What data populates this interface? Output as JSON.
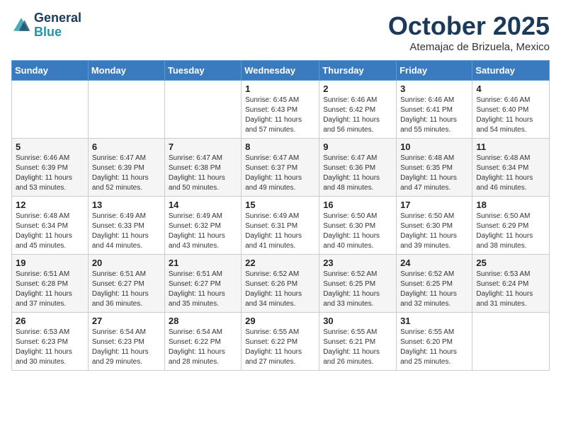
{
  "header": {
    "logo_line1": "General",
    "logo_line2": "Blue",
    "month_title": "October 2025",
    "subtitle": "Atemajac de Brizuela, Mexico"
  },
  "days_of_week": [
    "Sunday",
    "Monday",
    "Tuesday",
    "Wednesday",
    "Thursday",
    "Friday",
    "Saturday"
  ],
  "weeks": [
    [
      {
        "day": "",
        "sunrise": "",
        "sunset": "",
        "daylight": ""
      },
      {
        "day": "",
        "sunrise": "",
        "sunset": "",
        "daylight": ""
      },
      {
        "day": "",
        "sunrise": "",
        "sunset": "",
        "daylight": ""
      },
      {
        "day": "1",
        "sunrise": "6:45 AM",
        "sunset": "6:43 PM",
        "daylight": "11 hours and 57 minutes."
      },
      {
        "day": "2",
        "sunrise": "6:46 AM",
        "sunset": "6:42 PM",
        "daylight": "11 hours and 56 minutes."
      },
      {
        "day": "3",
        "sunrise": "6:46 AM",
        "sunset": "6:41 PM",
        "daylight": "11 hours and 55 minutes."
      },
      {
        "day": "4",
        "sunrise": "6:46 AM",
        "sunset": "6:40 PM",
        "daylight": "11 hours and 54 minutes."
      }
    ],
    [
      {
        "day": "5",
        "sunrise": "6:46 AM",
        "sunset": "6:39 PM",
        "daylight": "11 hours and 53 minutes."
      },
      {
        "day": "6",
        "sunrise": "6:47 AM",
        "sunset": "6:39 PM",
        "daylight": "11 hours and 52 minutes."
      },
      {
        "day": "7",
        "sunrise": "6:47 AM",
        "sunset": "6:38 PM",
        "daylight": "11 hours and 50 minutes."
      },
      {
        "day": "8",
        "sunrise": "6:47 AM",
        "sunset": "6:37 PM",
        "daylight": "11 hours and 49 minutes."
      },
      {
        "day": "9",
        "sunrise": "6:47 AM",
        "sunset": "6:36 PM",
        "daylight": "11 hours and 48 minutes."
      },
      {
        "day": "10",
        "sunrise": "6:48 AM",
        "sunset": "6:35 PM",
        "daylight": "11 hours and 47 minutes."
      },
      {
        "day": "11",
        "sunrise": "6:48 AM",
        "sunset": "6:34 PM",
        "daylight": "11 hours and 46 minutes."
      }
    ],
    [
      {
        "day": "12",
        "sunrise": "6:48 AM",
        "sunset": "6:34 PM",
        "daylight": "11 hours and 45 minutes."
      },
      {
        "day": "13",
        "sunrise": "6:49 AM",
        "sunset": "6:33 PM",
        "daylight": "11 hours and 44 minutes."
      },
      {
        "day": "14",
        "sunrise": "6:49 AM",
        "sunset": "6:32 PM",
        "daylight": "11 hours and 43 minutes."
      },
      {
        "day": "15",
        "sunrise": "6:49 AM",
        "sunset": "6:31 PM",
        "daylight": "11 hours and 41 minutes."
      },
      {
        "day": "16",
        "sunrise": "6:50 AM",
        "sunset": "6:30 PM",
        "daylight": "11 hours and 40 minutes."
      },
      {
        "day": "17",
        "sunrise": "6:50 AM",
        "sunset": "6:30 PM",
        "daylight": "11 hours and 39 minutes."
      },
      {
        "day": "18",
        "sunrise": "6:50 AM",
        "sunset": "6:29 PM",
        "daylight": "11 hours and 38 minutes."
      }
    ],
    [
      {
        "day": "19",
        "sunrise": "6:51 AM",
        "sunset": "6:28 PM",
        "daylight": "11 hours and 37 minutes."
      },
      {
        "day": "20",
        "sunrise": "6:51 AM",
        "sunset": "6:27 PM",
        "daylight": "11 hours and 36 minutes."
      },
      {
        "day": "21",
        "sunrise": "6:51 AM",
        "sunset": "6:27 PM",
        "daylight": "11 hours and 35 minutes."
      },
      {
        "day": "22",
        "sunrise": "6:52 AM",
        "sunset": "6:26 PM",
        "daylight": "11 hours and 34 minutes."
      },
      {
        "day": "23",
        "sunrise": "6:52 AM",
        "sunset": "6:25 PM",
        "daylight": "11 hours and 33 minutes."
      },
      {
        "day": "24",
        "sunrise": "6:52 AM",
        "sunset": "6:25 PM",
        "daylight": "11 hours and 32 minutes."
      },
      {
        "day": "25",
        "sunrise": "6:53 AM",
        "sunset": "6:24 PM",
        "daylight": "11 hours and 31 minutes."
      }
    ],
    [
      {
        "day": "26",
        "sunrise": "6:53 AM",
        "sunset": "6:23 PM",
        "daylight": "11 hours and 30 minutes."
      },
      {
        "day": "27",
        "sunrise": "6:54 AM",
        "sunset": "6:23 PM",
        "daylight": "11 hours and 29 minutes."
      },
      {
        "day": "28",
        "sunrise": "6:54 AM",
        "sunset": "6:22 PM",
        "daylight": "11 hours and 28 minutes."
      },
      {
        "day": "29",
        "sunrise": "6:55 AM",
        "sunset": "6:22 PM",
        "daylight": "11 hours and 27 minutes."
      },
      {
        "day": "30",
        "sunrise": "6:55 AM",
        "sunset": "6:21 PM",
        "daylight": "11 hours and 26 minutes."
      },
      {
        "day": "31",
        "sunrise": "6:55 AM",
        "sunset": "6:20 PM",
        "daylight": "11 hours and 25 minutes."
      },
      {
        "day": "",
        "sunrise": "",
        "sunset": "",
        "daylight": ""
      }
    ]
  ]
}
